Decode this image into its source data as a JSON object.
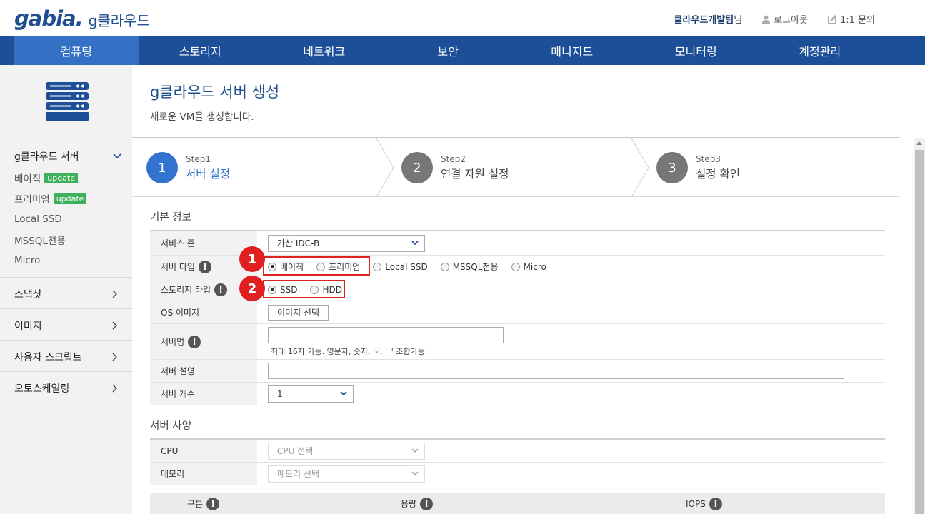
{
  "header": {
    "logo": "gabia.",
    "logo_sub": "g클라우드",
    "user_name": "클라우드개발팀",
    "user_suffix": "님",
    "logout": "로그아웃",
    "inquiry": "1:1 문의"
  },
  "nav": [
    "컴퓨팅",
    "스토리지",
    "네트워크",
    "보안",
    "매니지드",
    "모니터링",
    "계정관리"
  ],
  "sidebar": {
    "group_title": "g클라우드 서버",
    "subitems": [
      {
        "label": "베이직",
        "badge": "update"
      },
      {
        "label": "프리미엄",
        "badge": "update"
      },
      {
        "label": "Local SSD",
        "badge": ""
      },
      {
        "label": "MSSQL전용",
        "badge": ""
      },
      {
        "label": "Micro",
        "badge": ""
      }
    ],
    "links": [
      "스냅샷",
      "이미지",
      "사용자 스크립트",
      "오토스케일링"
    ]
  },
  "page": {
    "title": "g클라우드 서버 생성",
    "desc": "새로운 VM을 생성합니다."
  },
  "steps": [
    {
      "num": "1",
      "label": "Step1",
      "title": "서버 설정",
      "active": true
    },
    {
      "num": "2",
      "label": "Step2",
      "title": "연결 자원 설정",
      "active": false
    },
    {
      "num": "3",
      "label": "Step3",
      "title": "설정 확인",
      "active": false
    }
  ],
  "basic_info": {
    "section_title": "기본 정보",
    "zone_label": "서비스 존",
    "zone_value": "가산 IDC-B",
    "server_type_label": "서버 타입",
    "server_types": [
      "베이직",
      "프리미엄",
      "Local SSD",
      "MSSQL전용",
      "Micro"
    ],
    "storage_type_label": "스토리지 타입",
    "storage_types": [
      "SSD",
      "HDD"
    ],
    "os_label": "OS 이미지",
    "os_button": "이미지 선택",
    "name_label": "서버명",
    "name_hint": "최대 16자 가능. 영문자, 숫자, '-', '_' 조합가능.",
    "desc_label": "서버 설명",
    "count_label": "서버 개수",
    "count_value": "1",
    "info_glyph": "!"
  },
  "callouts": [
    "1",
    "2"
  ],
  "spec": {
    "section_title": "서버 사양",
    "cpu_label": "CPU",
    "cpu_placeholder": "CPU 선택",
    "mem_label": "메모리",
    "mem_placeholder": "메모리 선택",
    "columns": [
      "구분",
      "용량",
      "IOPS"
    ]
  },
  "colors": {
    "nav_bg": "#1c4f97",
    "nav_active": "#3470c4",
    "accent": "#3273cf",
    "callout": "#e02020",
    "badge": "#3cb05a"
  }
}
